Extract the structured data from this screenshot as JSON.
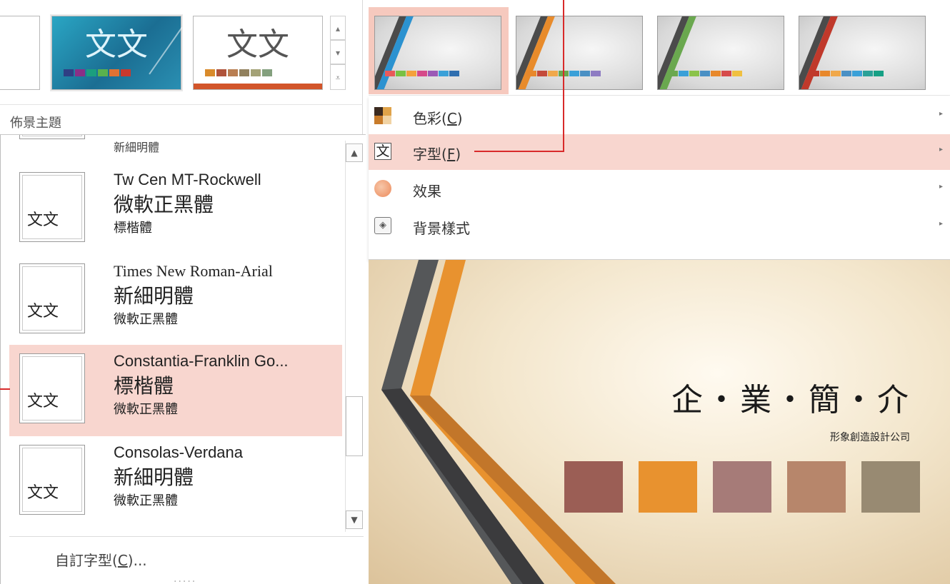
{
  "theme_gallery": {
    "label": "佈景主題",
    "thumbnail_text": "文文",
    "teal_swatches": [
      "#2f3f84",
      "#8a2f86",
      "#1b9f7e",
      "#59b24d",
      "#e07233",
      "#c8392e"
    ],
    "white_swatches": [
      "#d98b2b",
      "#b0533a",
      "#b97e52",
      "#92815e",
      "#a4a277",
      "#84a07e"
    ]
  },
  "font_list": {
    "items": [
      {
        "name": "",
        "heading": "",
        "body": "新細明體",
        "preview": ""
      },
      {
        "name": "Tw Cen MT-Rockwell",
        "heading": "微軟正黑體",
        "body": "標楷體",
        "preview": "文文"
      },
      {
        "name": "Times New Roman-Arial",
        "heading": "新細明體",
        "body": "微軟正黑體",
        "preview": "文文"
      },
      {
        "name": "Constantia-Franklin Go...",
        "heading": "標楷體",
        "body": "微軟正黑體",
        "preview": "文文"
      },
      {
        "name": "Consolas-Verdana",
        "heading": "新細明體",
        "body": "微軟正黑體",
        "preview": "文文"
      }
    ],
    "scroll_up": "▲",
    "scroll_down": "▼",
    "custom_fonts": {
      "prefix": "自訂字型(",
      "key": "C",
      "suffix": ")..."
    },
    "grip": "....."
  },
  "variants": {
    "items": [
      {
        "stripe": "#2b92d0",
        "dots": [
          "#e85a5a",
          "#7ac143",
          "#f4a13c",
          "#d64a8a",
          "#9b59b6",
          "#3aa0d8",
          "#2f6fb0"
        ]
      },
      {
        "stripe": "#e88b2b",
        "dots": [
          "#e8882b",
          "#c44a3a",
          "#f0a84a",
          "#6aa84f",
          "#3aa0d8",
          "#4a90c4",
          "#8e7cc3"
        ]
      },
      {
        "stripe": "#6aa84f",
        "dots": [
          "#6aa84f",
          "#3aa0d8",
          "#8bc34a",
          "#4a90c4",
          "#e8882b",
          "#d64a4a",
          "#f0c040"
        ]
      },
      {
        "stripe": "#c0392b",
        "dots": [
          "#c0392b",
          "#e8882b",
          "#f0a84a",
          "#4a90c4",
          "#3aa0d8",
          "#2aa198",
          "#16a085"
        ]
      }
    ]
  },
  "menu": {
    "items": [
      {
        "icon": "colors-icon",
        "prefix": "色彩(",
        "key": "C",
        "suffix": ")",
        "arrow": "▸"
      },
      {
        "icon": "fonts-icon",
        "prefix": "字型(",
        "key": "F",
        "suffix": ")",
        "arrow": "▸",
        "icon_glyph": "文"
      },
      {
        "icon": "effects-icon",
        "prefix": "效果",
        "key": "",
        "suffix": "",
        "arrow": "▸"
      },
      {
        "icon": "background-style-icon",
        "prefix": "背景樣式",
        "key": "",
        "suffix": "",
        "arrow": "▸",
        "icon_glyph": "◈"
      }
    ]
  },
  "slide": {
    "title": "企・業・簡・介",
    "subtitle": "形象創造設計公司",
    "squares": [
      "#9b5e55",
      "#e8922f",
      "#a67b78",
      "#b7866b",
      "#988a72"
    ],
    "stripes": [
      "#555759",
      "#e8922f",
      "#3b3b3d",
      "#c2762a"
    ]
  },
  "colors": {
    "highlight": "#f8d6cf",
    "callout": "#d82a2a"
  }
}
